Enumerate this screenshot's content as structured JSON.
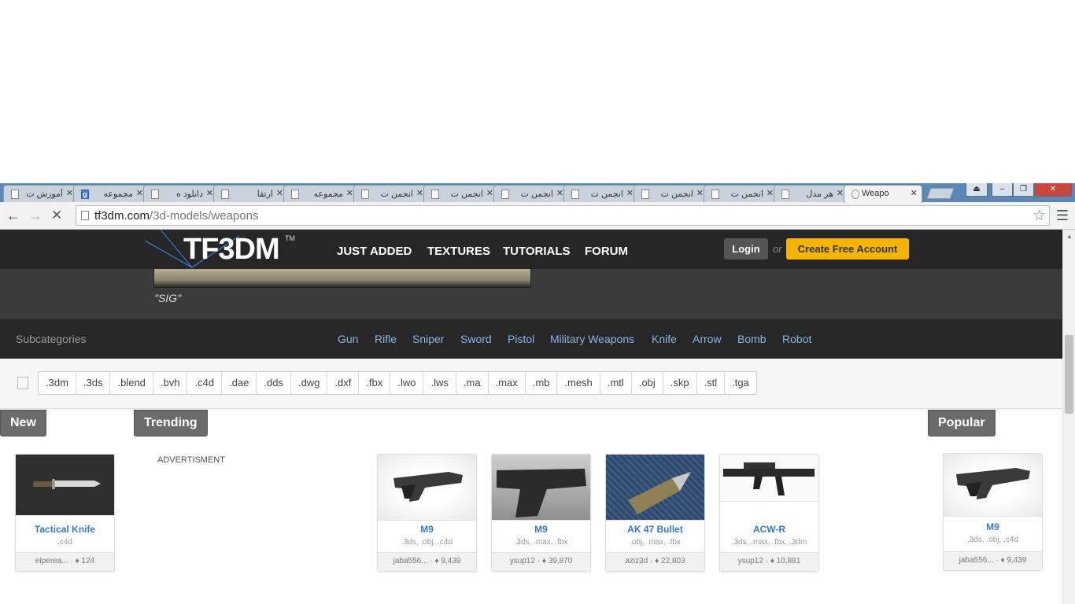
{
  "browser": {
    "tabs": [
      {
        "title": "آموزش ت",
        "favicon": "page-icon"
      },
      {
        "title": "مجموعه",
        "favicon": "google-icon"
      },
      {
        "title": "دانلود ه",
        "favicon": "page-icon"
      },
      {
        "title": "ارتقا",
        "favicon": "page-icon"
      },
      {
        "title": "مجموعه",
        "favicon": "page-icon"
      },
      {
        "title": "انجمن ت",
        "favicon": "page-icon"
      },
      {
        "title": "انجمن ت",
        "favicon": "page-icon"
      },
      {
        "title": "انجمن ت",
        "favicon": "page-icon"
      },
      {
        "title": "انجمن ت",
        "favicon": "page-icon"
      },
      {
        "title": "انجمن ت",
        "favicon": "page-icon"
      },
      {
        "title": "انجمن ت",
        "favicon": "page-icon"
      },
      {
        "title": "هر مدل",
        "favicon": "page-icon"
      },
      {
        "title": "Weapo",
        "favicon": "loading-spinner-icon",
        "active": true
      }
    ],
    "close_glyph": "✕",
    "url_domain": "tf3dm.com",
    "url_path": "/3d-models/weapons"
  },
  "site": {
    "logo": "TF3DM",
    "logo_tm": "TM",
    "nav": [
      "JUST ADDED",
      "TEXTURES",
      "TUTORIALS",
      "FORUM"
    ],
    "login": "Login",
    "or": "or",
    "create_account": "Create Free Account",
    "accent_color": "#f5b400"
  },
  "hero": {
    "caption": "\"SIG\""
  },
  "subcategories": {
    "title": "Subcategories",
    "items": [
      "Gun",
      "Rifle",
      "Sniper",
      "Sword",
      "Pistol",
      "Military Weapons",
      "Knife",
      "Arrow",
      "Bomb",
      "Robot"
    ]
  },
  "formats": [
    ".3dm",
    ".3ds",
    ".blend",
    ".bvh",
    ".c4d",
    ".dae",
    ".dds",
    ".dwg",
    ".dxf",
    ".fbx",
    ".lwo",
    ".lws",
    ".ma",
    ".max",
    ".mb",
    ".mesh",
    ".mtl",
    ".obj",
    ".skp",
    ".stl",
    ".tga"
  ],
  "sections": {
    "new": "New",
    "trending": "Trending",
    "popular": "Popular",
    "advertisement": "ADVERTISMENT"
  },
  "cards": [
    {
      "name": "Tactical Knife",
      "formats": ".c4d",
      "author": "elperea...",
      "downloads": "124"
    },
    {
      "name": "M9",
      "formats": ".3ds, .obj, .c4d",
      "author": "jaba556...",
      "downloads": "9,439"
    },
    {
      "name": "M9",
      "formats": ".3ds, .max, .fbx",
      "author": "ysup12",
      "downloads": "39,870"
    },
    {
      "name": "AK 47 Bullet",
      "formats": ".obj, .max, .fbx",
      "author": "aziz3d",
      "downloads": "22,803"
    },
    {
      "name": "ACW-R",
      "formats": ".3ds, .max, .fbx, .3dm",
      "author": "ysup12",
      "downloads": "10,881"
    },
    {
      "name": "M9",
      "formats": ".3ds, .obj, .c4d",
      "author": "jaba556...",
      "downloads": "9,439"
    }
  ]
}
